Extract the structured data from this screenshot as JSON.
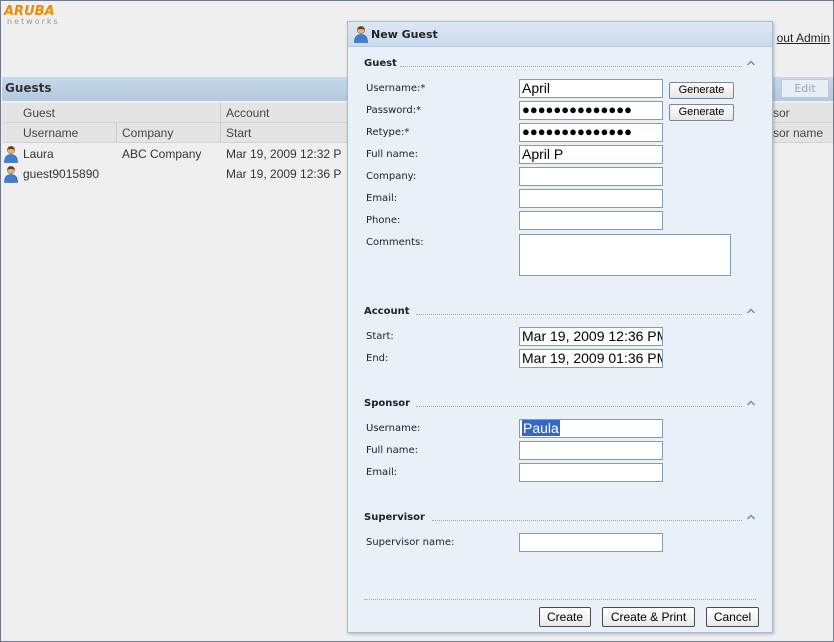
{
  "brand": {
    "name": "ARUBA",
    "tagline": "networks"
  },
  "header": {
    "logout_label": "out Admin"
  },
  "guests_panel": {
    "title": "Guests",
    "edit_label": "Edit",
    "group_headers": [
      "Guest",
      "Account",
      "sor"
    ],
    "columns": [
      "Username",
      "Company",
      "Start",
      "sor name"
    ],
    "rows": [
      {
        "username": "Laura",
        "company": "ABC Company",
        "start": "Mar 19, 2009 12:32 P"
      },
      {
        "username": "guest9015890",
        "company": "",
        "start": "Mar 19, 2009 12:36 P"
      }
    ]
  },
  "dialog": {
    "title": "New Guest",
    "sections": {
      "guest": "Guest",
      "account": "Account",
      "sponsor": "Sponsor",
      "supervisor": "Supervisor"
    },
    "guest_fields": {
      "username_label": "Username:*",
      "username_value": "April",
      "password_label": "Password:*",
      "password_value": "●●●●●●●●●●●●●●",
      "retype_label": "Retype:*",
      "retype_value": "●●●●●●●●●●●●●●",
      "fullname_label": "Full name:",
      "fullname_value": "April P",
      "company_label": "Company:",
      "company_value": "",
      "email_label": "Email:",
      "email_value": "",
      "phone_label": "Phone:",
      "phone_value": "",
      "comments_label": "Comments:",
      "comments_value": "",
      "generate_label": "Generate"
    },
    "account_fields": {
      "start_label": "Start:",
      "start_value": "Mar 19, 2009 12:36 PM",
      "end_label": "End:",
      "end_value": "Mar 19, 2009 01:36 PM"
    },
    "sponsor_fields": {
      "username_label": "Username:",
      "username_value": "Paula",
      "fullname_label": "Full name:",
      "fullname_value": "",
      "email_label": "Email:",
      "email_value": ""
    },
    "supervisor_fields": {
      "name_label": "Supervisor name:",
      "name_value": ""
    },
    "buttons": {
      "create": "Create",
      "create_print": "Create & Print",
      "cancel": "Cancel"
    }
  },
  "colors": {
    "brand_orange": "#f08a00",
    "title_bar": "#cbdaeb",
    "dialog_bg": "#e9f0f8",
    "selection": "#316ac5"
  },
  "icons": [
    "user-icon",
    "collapse-arrow-icon"
  ]
}
